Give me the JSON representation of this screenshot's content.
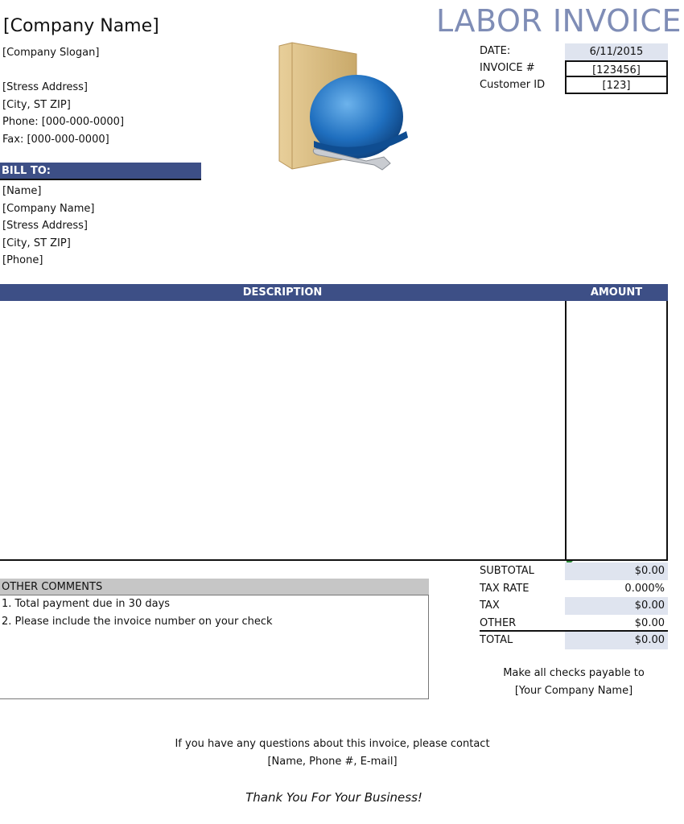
{
  "header": {
    "company_name": "[Company Name]",
    "company_slogan": "[Company Slogan]",
    "address": "[Stress Address]",
    "city_state_zip": "[City, ST  ZIP]",
    "phone": "Phone: [000-000-0000]",
    "fax": "Fax: [000-000-0000]",
    "title": "LABOR INVOICE"
  },
  "meta": {
    "date_label": "DATE:",
    "date_value": "6/11/2015",
    "invoice_label": "INVOICE #",
    "invoice_value": "[123456]",
    "customer_label": "Customer ID",
    "customer_value": "[123]"
  },
  "logo": {
    "icon": "folder-hardhat-wrench-icon"
  },
  "bill_to": {
    "header": "BILL TO:",
    "name": "[Name]",
    "company": "[Company Name]",
    "address": "[Stress Address]",
    "city_state_zip": "[City, ST  ZIP]",
    "phone": "[Phone]"
  },
  "table": {
    "col_description": "DESCRIPTION",
    "col_amount": "AMOUNT",
    "rows": []
  },
  "comments": {
    "header": "OTHER COMMENTS",
    "lines": [
      "1. Total payment due in 30 days",
      "2. Please include the invoice number on your check"
    ]
  },
  "totals": {
    "subtotal_label": "SUBTOTAL",
    "subtotal_value": "$0.00",
    "tax_rate_label": "TAX RATE",
    "tax_rate_value": "0.000%",
    "tax_label": "TAX",
    "tax_value": "$0.00",
    "other_label": "OTHER",
    "other_value": "$0.00",
    "total_label": "TOTAL",
    "total_value": "$0.00"
  },
  "payable": {
    "line1": "Make all checks payable to",
    "line2": "[Your Company Name]"
  },
  "footer": {
    "line1": "If you have any questions about this invoice, please contact",
    "line2": "[Name, Phone #, E-mail]",
    "thanks": "Thank You For Your Business!"
  },
  "colors": {
    "header_band": "#3d4f86",
    "title": "#7f8db6",
    "shade": "#dfe4ef",
    "comments_band": "#c6c6c6"
  }
}
